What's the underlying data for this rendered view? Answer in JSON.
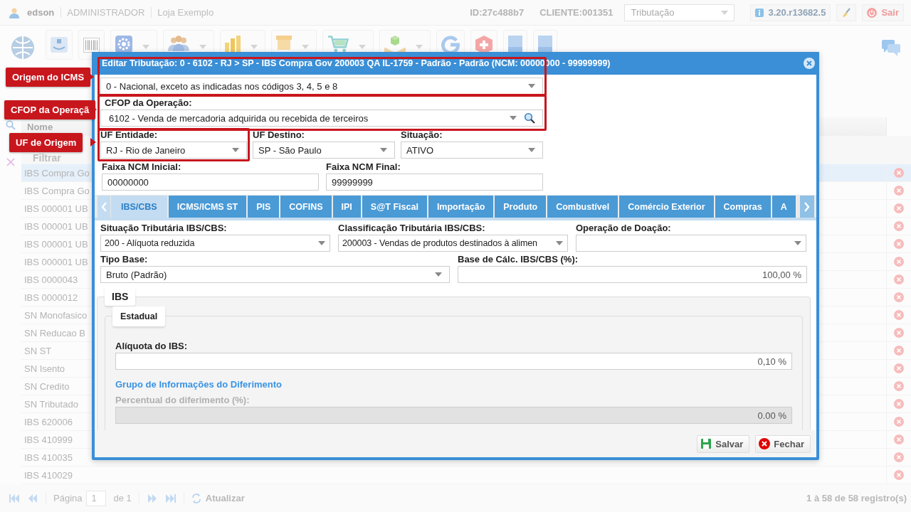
{
  "top_bar": {
    "user": "edson",
    "role": "ADMINISTRADOR",
    "store": "Loja Exemplo",
    "id": "ID:27c488b7",
    "client": "CLIENTE:001351",
    "module": "Tributação",
    "version": "3.20.r13682.5",
    "logout": "Sair"
  },
  "grid": {
    "column": "Nome",
    "filter": "Filtrar",
    "rows": [
      {
        "name": "IBS Compra Go",
        "selected": true
      },
      {
        "name": "IBS Compra Go",
        "selected": false
      },
      {
        "name": "IBS 000001 UB",
        "selected": false
      },
      {
        "name": "IBS 000001 UB",
        "selected": false
      },
      {
        "name": "IBS 000001 UB",
        "selected": false
      },
      {
        "name": "IBS 000001 UB",
        "selected": false
      },
      {
        "name": "IBS 0000043",
        "selected": false
      },
      {
        "name": "IBS 0000012",
        "selected": false
      },
      {
        "name": "SN Monofasico",
        "selected": false
      },
      {
        "name": "SN Reducao B",
        "selected": false
      },
      {
        "name": "SN ST",
        "selected": false
      },
      {
        "name": "SN Isento",
        "selected": false
      },
      {
        "name": "SN Credito",
        "selected": false
      },
      {
        "name": "SN Tributado",
        "selected": false
      },
      {
        "name": "IBS 620006",
        "selected": false
      },
      {
        "name": "IBS 410999",
        "selected": false
      },
      {
        "name": "IBS 410035",
        "selected": false
      },
      {
        "name": "IBS 410029",
        "selected": false
      }
    ]
  },
  "pager": {
    "page_label": "Página",
    "page": "1",
    "of": "de 1",
    "refresh": "Atualizar",
    "summary": "1 à 58 de 58 registro(s)"
  },
  "dialog": {
    "title": "Editar Tributação: 0 - 6102 - RJ > SP - IBS Compra Gov 200003 QA IL-1759 - Padrão - Padrão (NCM: 00000000 - 99999999)",
    "sections": [
      {
        "fields": [
          {
            "kind": "select",
            "value": "0 - Nacional, exceto as indicadas nos códigos 3, 4, 5 e 8"
          }
        ]
      },
      {
        "fields": [
          {
            "kind": "select",
            "label": "CFOP da Operação:",
            "value": "6102 - Venda de mercadoria adquirida ou recebida de terceiros",
            "search": true
          }
        ]
      },
      {
        "fields": [
          {
            "kind": "select",
            "label": "UF Entidade:",
            "value": "RJ - Rio de Janeiro"
          },
          {
            "kind": "select",
            "label": "UF Destino:",
            "value": "SP - São Paulo"
          },
          {
            "kind": "select",
            "label": "Situação:",
            "value": "ATIVO"
          }
        ]
      },
      {
        "fields": [
          {
            "kind": "text",
            "label": "Faixa NCM Inicial:",
            "value": "00000000"
          },
          {
            "kind": "text",
            "label": "Faixa NCM Final:",
            "value": "99999999"
          }
        ]
      }
    ],
    "tabs": [
      {
        "label": "IBS/CBS",
        "selected": true
      },
      {
        "label": "ICMS/ICMS ST",
        "selected": false
      },
      {
        "label": "PIS",
        "selected": false
      },
      {
        "label": "COFINS",
        "selected": false
      },
      {
        "label": "IPI",
        "selected": false
      },
      {
        "label": "S@T Fiscal",
        "selected": false
      },
      {
        "label": "Importação",
        "selected": false
      },
      {
        "label": "Produto",
        "selected": false
      },
      {
        "label": "Combustível",
        "selected": false
      },
      {
        "label": "Comércio Exterior",
        "selected": false
      },
      {
        "label": "Compras",
        "selected": false
      },
      {
        "label": "A",
        "selected": false
      }
    ],
    "tab_sections": [
      {
        "fields": [
          {
            "kind": "select",
            "label": "Situação Tributária IBS/CBS:",
            "value": "200 - Alíquota reduzida"
          },
          {
            "kind": "select",
            "label": "Classificação Tributária IBS/CBS:",
            "value": "200003 - Vendas de produtos destinados à alimen"
          },
          {
            "kind": "select",
            "label": "Operação de Doação:"
          }
        ]
      },
      {
        "fields": [
          {
            "kind": "select",
            "label": "Tipo Base:",
            "value": "Bruto (Padrão)"
          },
          {
            "kind": "number",
            "label": "Base de Cálc. IBS/CBS (%):",
            "value": "100,00 %"
          }
        ]
      }
    ],
    "panel": {
      "legend": "IBS",
      "group": {
        "legend": "Estadual",
        "fields": [
          {
            "kind": "number",
            "label": "Alíquota do IBS:",
            "value": "0,10 %",
            "disabled": false
          }
        ],
        "section": "Grupo de Informações do Diferimento",
        "section_fields": [
          {
            "kind": "number",
            "label": "Percentual do diferimento (%):",
            "value": "0.00 %",
            "disabled": true
          }
        ]
      }
    },
    "buttons": [
      {
        "kind": "save",
        "label": "Salvar"
      },
      {
        "kind": "close",
        "label": "Fechar"
      }
    ]
  },
  "annotations": [
    {
      "label": "Origem do ICMS"
    },
    {
      "label": "CFOP da Operaçã"
    },
    {
      "label": "UF de Origem"
    }
  ]
}
